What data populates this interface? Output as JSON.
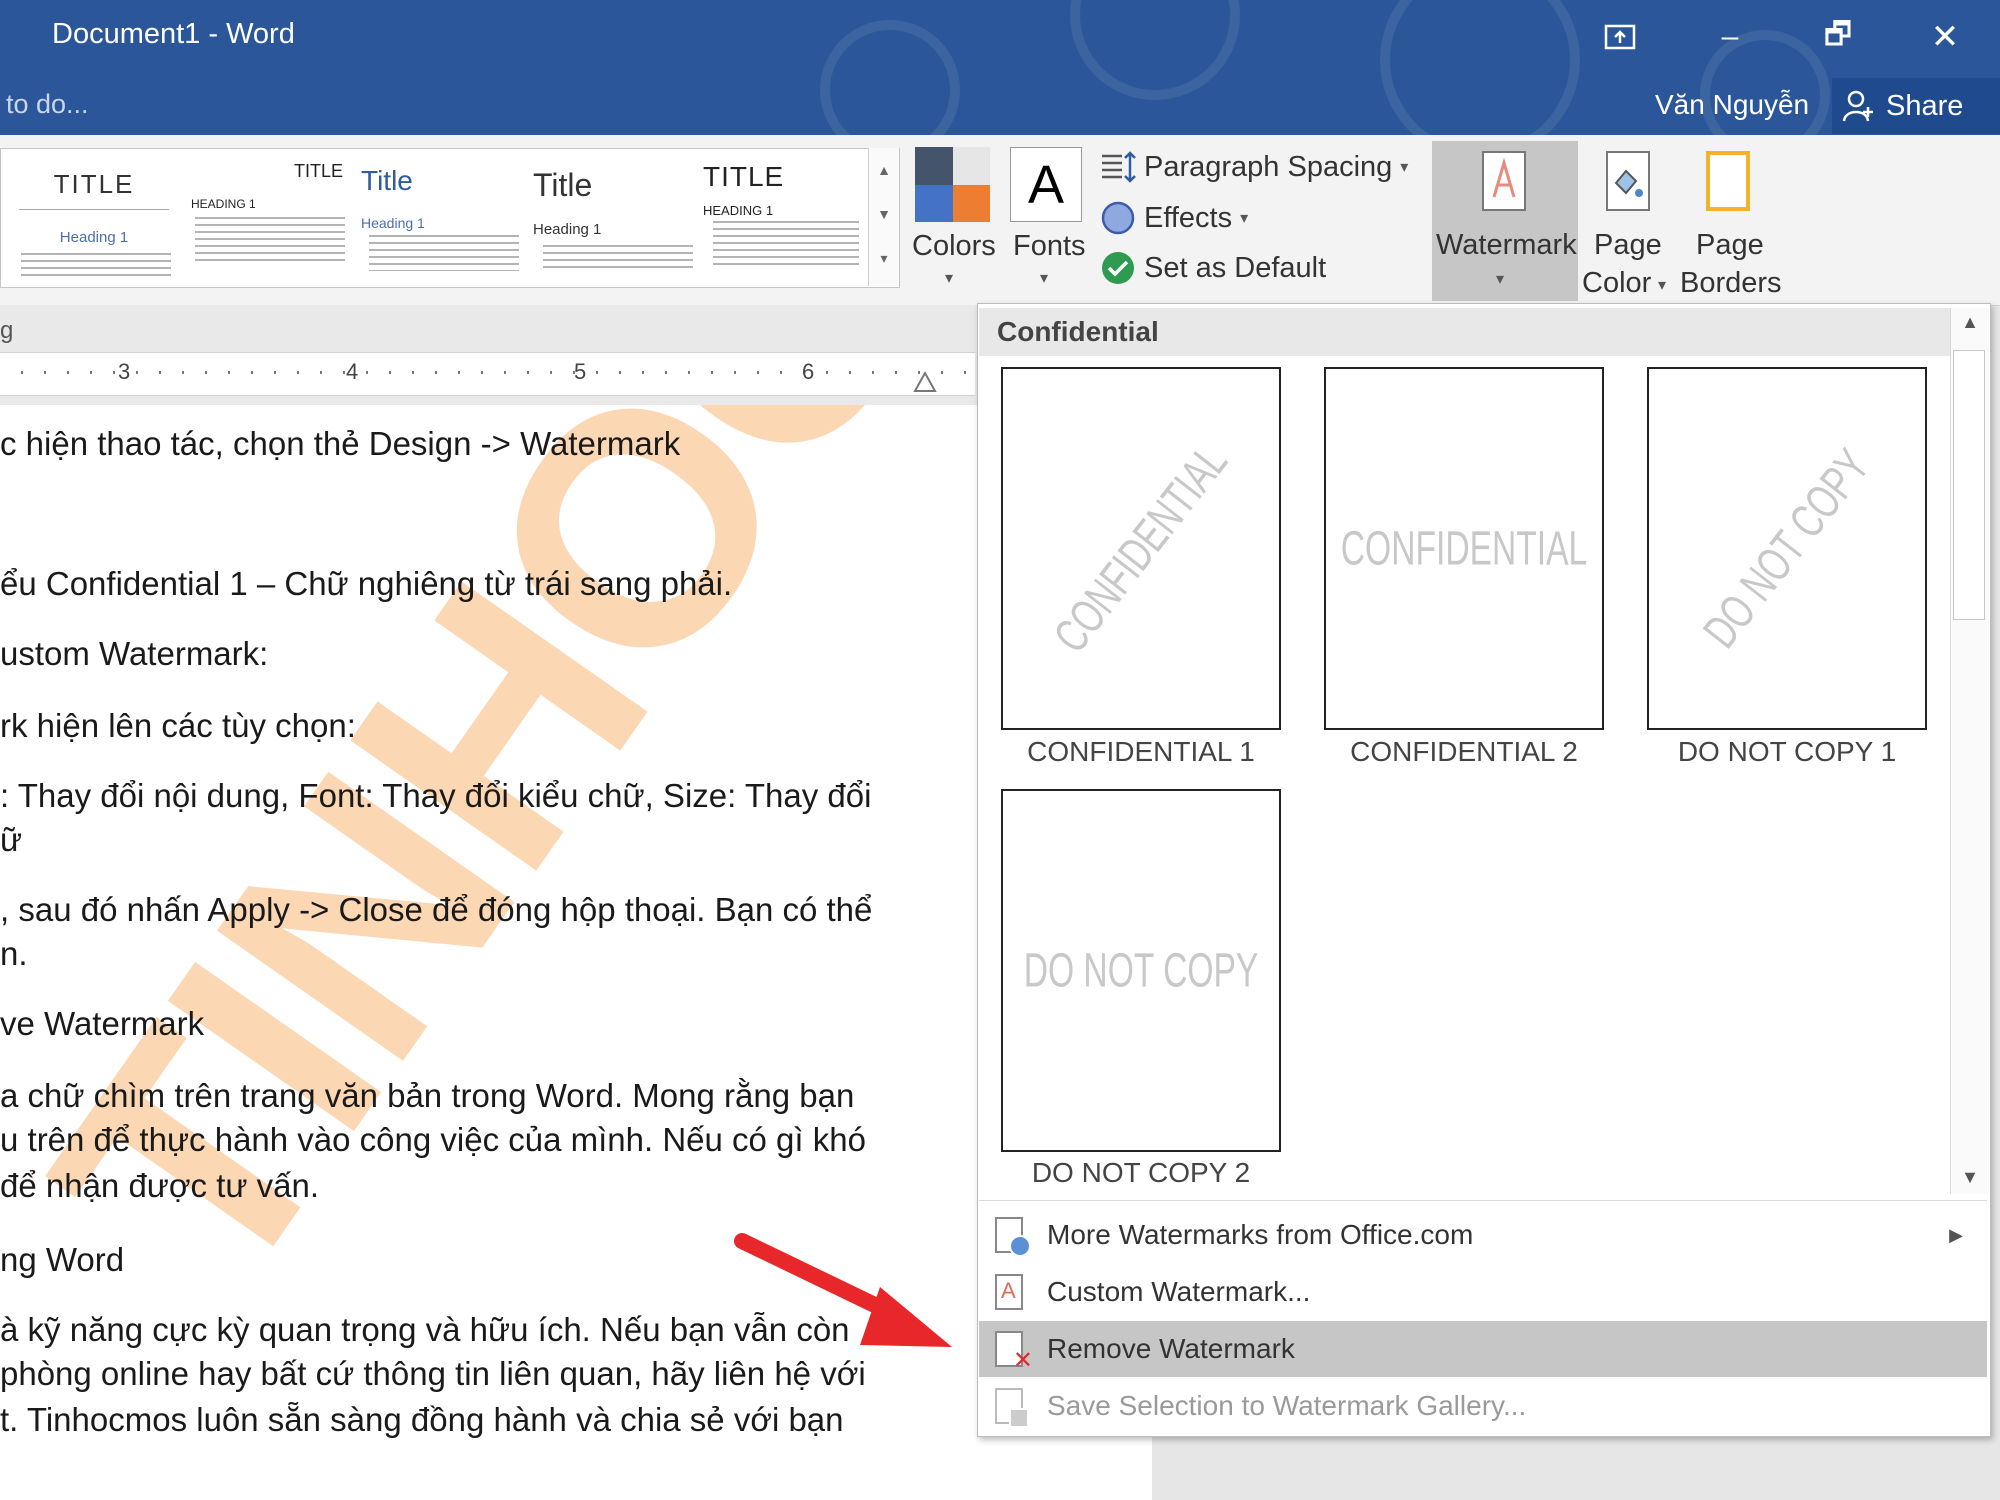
{
  "window": {
    "title": "Document1 - Word",
    "tell_me": "to do...",
    "user": "Văn Nguyễn",
    "share_label": "Share",
    "controls": {
      "display_icon": "ribbon-display-icon",
      "minimize": "–",
      "restore": "🗗",
      "close": "✕"
    }
  },
  "ribbon": {
    "style_gallery": [
      {
        "title": "TITLE",
        "heading": "Heading 1"
      },
      {
        "title": "TITLE",
        "heading": "HEADING 1"
      },
      {
        "title": "Title",
        "heading": "Heading 1"
      },
      {
        "title": "Title",
        "heading": "Heading 1"
      },
      {
        "title": "TITLE",
        "heading": "HEADING 1"
      }
    ],
    "colors_label": "Colors",
    "fonts_label": "Fonts",
    "fonts_glyph": "A",
    "paragraph_spacing": "Paragraph Spacing",
    "effects": "Effects",
    "set_default": "Set as Default",
    "watermark": "Watermark",
    "page_color_1": "Page",
    "page_color_2": "Color",
    "page_borders_1": "Page",
    "page_borders_2": "Borders",
    "group_fragment": "g"
  },
  "ruler": {
    "numbers": [
      "3",
      "4",
      "5",
      "6"
    ]
  },
  "document": {
    "lines": [
      "c hiện thao tác, chọn thẻ Design -> Watermark",
      "ểu Confidential 1 – Chữ nghiêng từ trái sang phải.",
      "ustom Watermark:",
      "rk hiện lên các tùy chọn:",
      ": Thay đổi nội dung, Font: Thay đổi kiểu chữ, Size: Thay đổi",
      "ữ",
      ", sau đó nhấn Apply -> Close để đóng hộp thoại. Bạn có thể",
      "n.",
      "ve Watermark",
      "a chữ chìm trên trang văn bản trong Word. Mong rằng bạn",
      "u trên để thực hành vào công việc của mình. Nếu có gì khó",
      "để nhận được tư vấn.",
      "ng Word",
      "à kỹ năng cực kỳ quan trọng và hữu ích. Nếu bạn vẫn còn",
      "phòng online hay bất cứ thông tin liên quan, hãy liên hệ với",
      "t. Tinhocmos luôn sẵn sàng đồng hành và chia sẻ với bạn"
    ],
    "watermark": "TINHOCMOS"
  },
  "watermark_menu": {
    "section": "Confidential",
    "tiles": [
      {
        "caption": "CONFIDENTIAL 1",
        "text": "CONFIDENTIAL"
      },
      {
        "caption": "CONFIDENTIAL 2",
        "text": "CONFIDENTIAL"
      },
      {
        "caption": "DO NOT COPY 1",
        "text": "DO NOT COPY"
      },
      {
        "caption": "DO NOT COPY 2",
        "text": "DO NOT COPY"
      }
    ],
    "items": {
      "more": "More Watermarks from Office.com",
      "custom": "Custom Watermark...",
      "remove": "Remove Watermark",
      "save": "Save Selection to Watermark Gallery..."
    }
  },
  "colors": {
    "titlebar": "#2b579a",
    "highlight": "#c6c6c6",
    "arrow": "#e8272b",
    "watermark_orange": "#f7a85b"
  }
}
